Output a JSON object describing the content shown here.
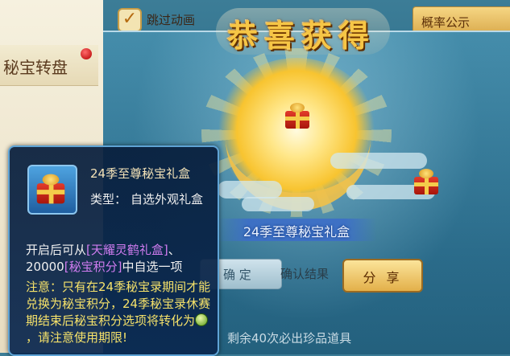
{
  "left_panel": {
    "tab_label": "秘宝转盘"
  },
  "top_bar": {
    "skip_label": "跳过动画",
    "probability_label": "概率公示"
  },
  "popup": {
    "title": "恭喜获得",
    "item_name": "24季至尊秘宝礼盒",
    "confirm_label": "确 定",
    "confirm_result_label": "确认结果",
    "share_label": "分 享",
    "bottom_note": "剩余40次必出珍品道具"
  },
  "tooltip": {
    "item_name": "24季至尊秘宝礼盒",
    "type_label": "类型：",
    "type_value": "自选外观礼盒",
    "desc_prefix": "开启后可从",
    "desc_option1": "[天耀灵鹤礼盒]",
    "desc_mid": "、20000",
    "desc_option2": "[秘宝积分]",
    "desc_suffix": "中自选一项",
    "note_main": "注意：只有在24季秘宝录期间才能兑换为秘宝积分，24季秘宝录休赛期结束后秘宝积分选项将转化为",
    "note_end": "，请注意使用期限!"
  },
  "colors": {
    "title_gold": "#f6c646",
    "tooltip_highlight": "#d07cf0",
    "tooltip_note": "#f6e26a",
    "tooltip_bg": "#0a2850"
  },
  "icons": [
    "check-icon",
    "gift-box-icon",
    "currency-coin-icon",
    "notification-dot-icon"
  ]
}
